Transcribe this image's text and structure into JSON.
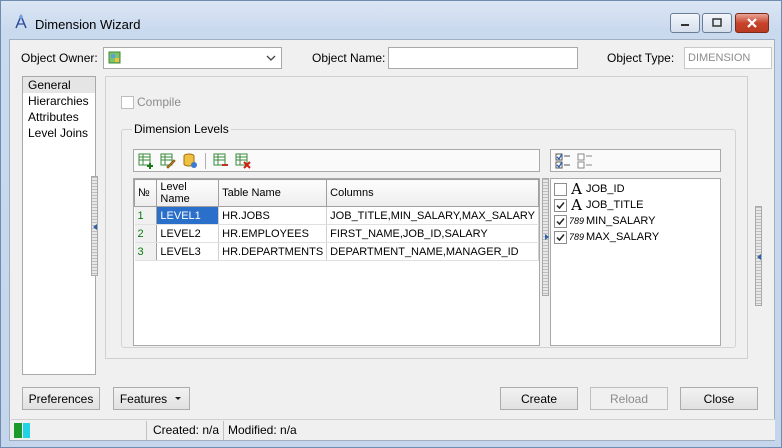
{
  "window": {
    "title": "Dimension Wizard"
  },
  "header": {
    "owner_label": "Object Owner:",
    "owner_value": "",
    "name_label": "Object Name:",
    "name_value": "",
    "type_label": "Object Type:",
    "type_value": "DIMENSION"
  },
  "nav": {
    "items": [
      "General",
      "Hierarchies",
      "Attributes",
      "Level Joins"
    ],
    "selected": "General"
  },
  "general": {
    "compile_label": "Compile",
    "group_title": "Dimension Levels",
    "grid": {
      "columns": [
        "№",
        "Level Name",
        "Table Name",
        "Columns"
      ],
      "rows": [
        {
          "num": "1",
          "level": "LEVEL1",
          "table": "HR.JOBS",
          "columns": "JOB_TITLE,MIN_SALARY,MAX_SALARY"
        },
        {
          "num": "2",
          "level": "LEVEL2",
          "table": "HR.EMPLOYEES",
          "columns": "FIRST_NAME,JOB_ID,SALARY"
        },
        {
          "num": "3",
          "level": "LEVEL3",
          "table": "HR.DEPARTMENTS",
          "columns": "DEPARTMENT_NAME,MANAGER_ID"
        }
      ]
    },
    "column_list": [
      {
        "name": "JOB_ID",
        "checked": false,
        "type": "text-type-icon"
      },
      {
        "name": "JOB_TITLE",
        "checked": true,
        "type": "text-type-icon"
      },
      {
        "name": "MIN_SALARY",
        "checked": true,
        "type": "number-type-icon"
      },
      {
        "name": "MAX_SALARY",
        "checked": true,
        "type": "number-type-icon"
      }
    ],
    "number_type_glyph": "789",
    "text_type_glyph": "A"
  },
  "buttons": {
    "preferences": "Preferences",
    "features": "Features",
    "create": "Create",
    "reload": "Reload",
    "close": "Close"
  },
  "status": {
    "created": "Created: n/a",
    "modified": "Modified: n/a"
  },
  "colors": {
    "accent": "#2a6fc9",
    "status_green": "#1a9a2a",
    "status_cyan": "#22d3e6"
  }
}
